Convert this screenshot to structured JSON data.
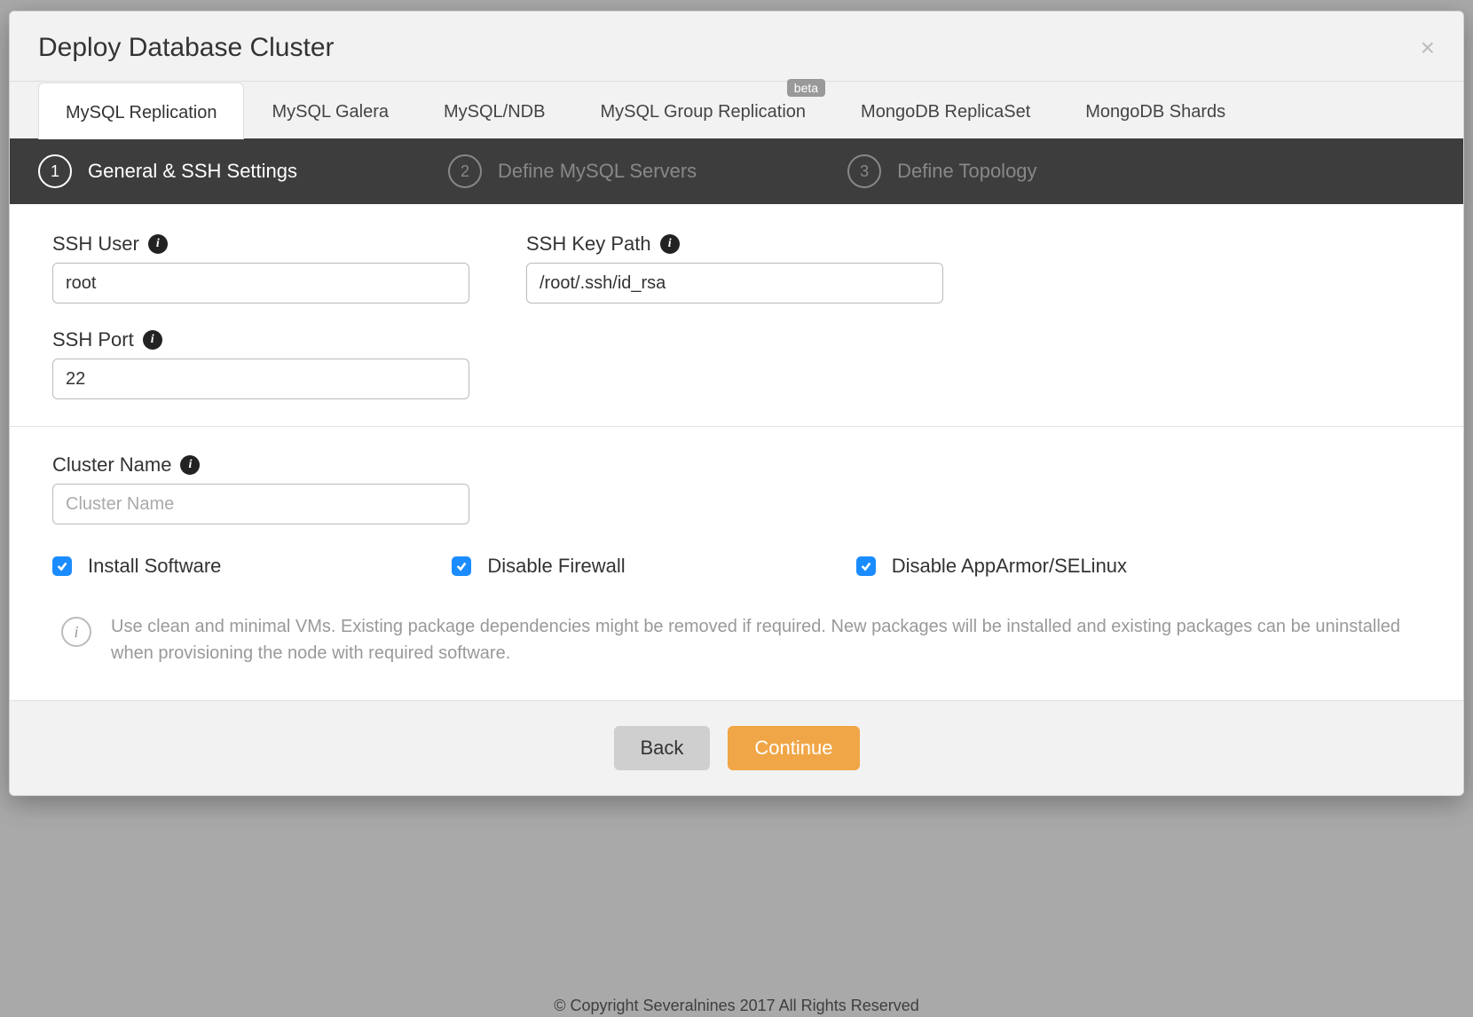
{
  "modal": {
    "title": "Deploy Database Cluster"
  },
  "tabs": [
    {
      "label": "MySQL Replication",
      "active": true,
      "badge": null
    },
    {
      "label": "MySQL Galera",
      "active": false,
      "badge": null
    },
    {
      "label": "MySQL/NDB",
      "active": false,
      "badge": null
    },
    {
      "label": "MySQL Group Replication",
      "active": false,
      "badge": "beta"
    },
    {
      "label": "MongoDB ReplicaSet",
      "active": false,
      "badge": null
    },
    {
      "label": "MongoDB Shards",
      "active": false,
      "badge": null
    }
  ],
  "steps": [
    {
      "num": "1",
      "label": "General & SSH Settings",
      "active": true
    },
    {
      "num": "2",
      "label": "Define MySQL Servers",
      "active": false
    },
    {
      "num": "3",
      "label": "Define Topology",
      "active": false
    }
  ],
  "form": {
    "ssh_user": {
      "label": "SSH User",
      "value": "root"
    },
    "ssh_key_path": {
      "label": "SSH Key Path",
      "value": "/root/.ssh/id_rsa"
    },
    "ssh_port": {
      "label": "SSH Port",
      "value": "22"
    },
    "cluster_name": {
      "label": "Cluster Name",
      "placeholder": "Cluster Name",
      "value": ""
    }
  },
  "checkboxes": {
    "install_software": {
      "label": "Install Software",
      "checked": true
    },
    "disable_firewall": {
      "label": "Disable Firewall",
      "checked": true
    },
    "disable_apparmor": {
      "label": "Disable AppArmor/SELinux",
      "checked": true
    }
  },
  "note": "Use clean and minimal VMs. Existing package dependencies might be removed if required. New packages will be installed and existing packages can be uninstalled when provisioning the node with required software.",
  "buttons": {
    "back": "Back",
    "continue": "Continue"
  },
  "backdrop_footer": "© Copyright Severalnines 2017 All Rights Reserved"
}
